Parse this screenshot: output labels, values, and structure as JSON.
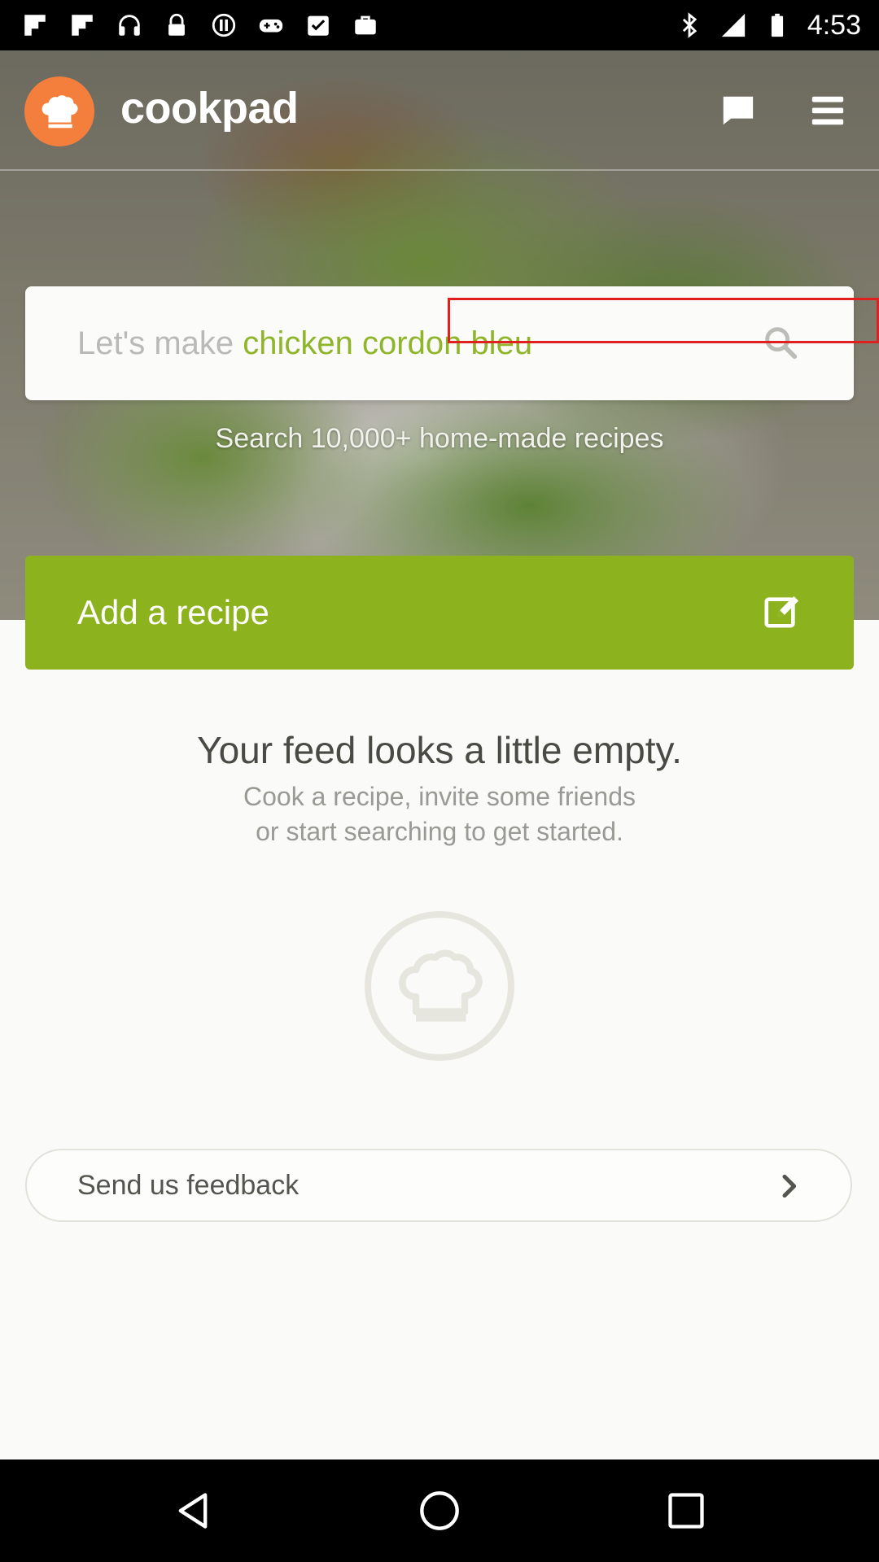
{
  "status_bar": {
    "time": "4:53",
    "icons": [
      "flipboard-icon",
      "flipboard-icon",
      "headset-icon",
      "lock-icon",
      "block-icon",
      "gamepad-icon",
      "checklist-icon",
      "bag-icon",
      "bluetooth-icon",
      "signal-icon",
      "battery-icon"
    ]
  },
  "app": {
    "name": "cookpad",
    "brand_orange": "#f47f3d",
    "brand_green": "#8cb21e"
  },
  "search": {
    "placeholder_prefix": "Let's make ",
    "placeholder_highlight": "chicken cordon bleu",
    "subtitle": "Search 10,000+ home-made recipes"
  },
  "add_recipe": {
    "label": "Add a recipe"
  },
  "feed": {
    "title": "Your feed looks a little empty.",
    "subtitle_line1": "Cook a recipe, invite some friends",
    "subtitle_line2": "or start searching to get started."
  },
  "feedback": {
    "label": "Send us feedback"
  }
}
